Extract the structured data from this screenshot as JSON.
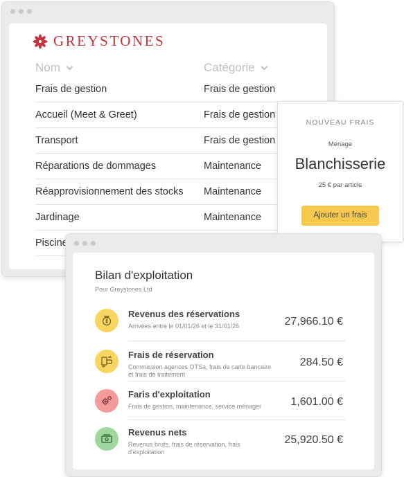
{
  "brand": {
    "name": "GREYSTONES",
    "color": "#c8323c"
  },
  "fees_table": {
    "columns": [
      "Nom",
      "Catégorie"
    ],
    "rows": [
      {
        "name": "Frais de gestion",
        "category": "Frais de gestion"
      },
      {
        "name": "Accueil (Meet & Greet)",
        "category": "Frais de gestion"
      },
      {
        "name": "Transport",
        "category": "Frais de gestion"
      },
      {
        "name": "Réparations de dommages",
        "category": "Maintenance"
      },
      {
        "name": "Réapprovisionnement des stocks",
        "category": "Maintenance"
      },
      {
        "name": "Jardinage",
        "category": "Maintenance"
      },
      {
        "name": "Piscine",
        "category": ""
      }
    ]
  },
  "new_fee_card": {
    "kicker": "NOUVEAU FRAIS",
    "category": "Ménage",
    "title": "Blanchisserie",
    "price": "25 € par article",
    "button_label": "Ajouter un frais",
    "button_color": "#f7c94d"
  },
  "report": {
    "title": "Bilan d'exploitation",
    "subtitle": "Pour Greystones Ltd",
    "items": [
      {
        "icon": "money-bag-icon",
        "icon_bg": "#f7d560",
        "name": "Revenus des réservations",
        "description": "Arrivées entre le 01/01/26 et le 31/01/26",
        "amount": "27,966.10 €"
      },
      {
        "icon": "card-transfer-icon",
        "icon_bg": "#f7d560",
        "name": "Frais de réservation",
        "description": "Commission agences OTSa, frais de carte bancaire et frais de traitement",
        "amount": "284.50 €"
      },
      {
        "icon": "gears-icon",
        "icon_bg": "#f39a9a",
        "name": "Faris d'exploitation",
        "description": "Frais de gestion, maintenance, service ménager",
        "amount": "1,601.00 €"
      },
      {
        "icon": "cash-icon",
        "icon_bg": "#9ed69e",
        "name": "Revenus nets",
        "description": "Revenus bruts, frais de réservation, frais d'exploitation",
        "amount": "25,920.50 €"
      }
    ]
  }
}
